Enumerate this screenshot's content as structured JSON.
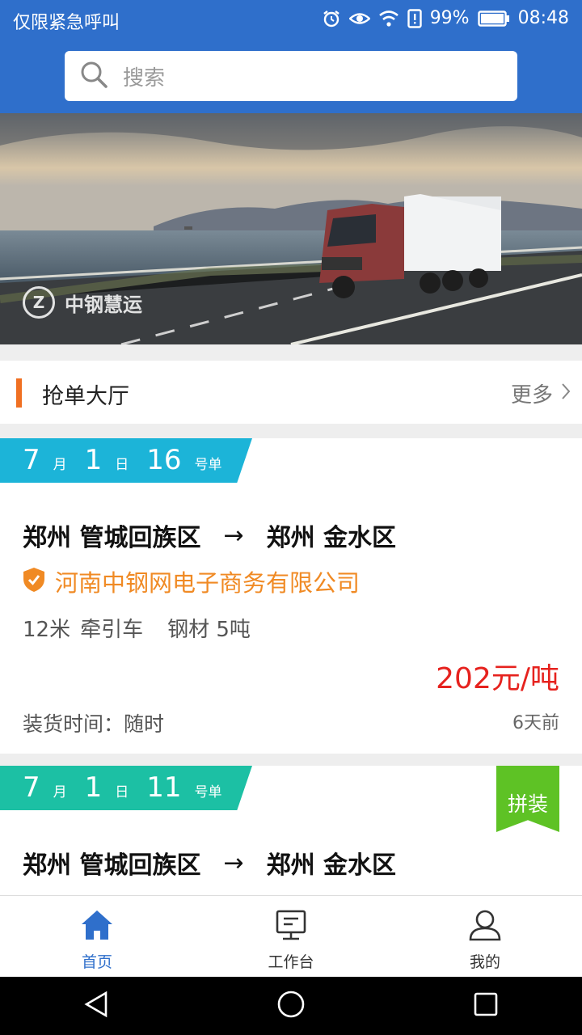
{
  "status_bar": {
    "carrier": "仅限紧急呼叫",
    "battery": "99%",
    "time": "08:48"
  },
  "search": {
    "placeholder": "搜索"
  },
  "banner": {
    "logo_text": "中钢慧运"
  },
  "section": {
    "title": "抢单大厅",
    "more": "更多"
  },
  "orders": [
    {
      "month": "7",
      "month_unit": "月",
      "day": "1",
      "day_unit": "日",
      "number": "16",
      "number_unit": "号单",
      "from": "郑州 管城回族区",
      "arrow": "→",
      "to": "郑州 金水区",
      "company": "河南中钢网电子商务有限公司",
      "length": "12米",
      "vehicle": "牵引车",
      "cargo": "钢材 5吨",
      "price": "202元/吨",
      "load_time": "装货时间：随时",
      "posted": "6天前"
    },
    {
      "month": "7",
      "month_unit": "月",
      "day": "1",
      "day_unit": "日",
      "number": "11",
      "number_unit": "号单",
      "from": "郑州 管城回族区",
      "arrow": "→",
      "to": "郑州 金水区",
      "tag": "拼装"
    }
  ],
  "tabs": [
    {
      "label": "首页",
      "icon": "home-icon",
      "active": true
    },
    {
      "label": "工作台",
      "icon": "workbench-icon",
      "active": false
    },
    {
      "label": "我的",
      "icon": "profile-icon",
      "active": false
    }
  ],
  "colors": {
    "brand_blue": "#2f6fcb",
    "price_red": "#e6221e",
    "company_orange": "#f08a24",
    "ribbon_blue": "#1cb4d8",
    "ribbon_teal": "#1cc0a4",
    "tag_green": "#5ec225"
  }
}
